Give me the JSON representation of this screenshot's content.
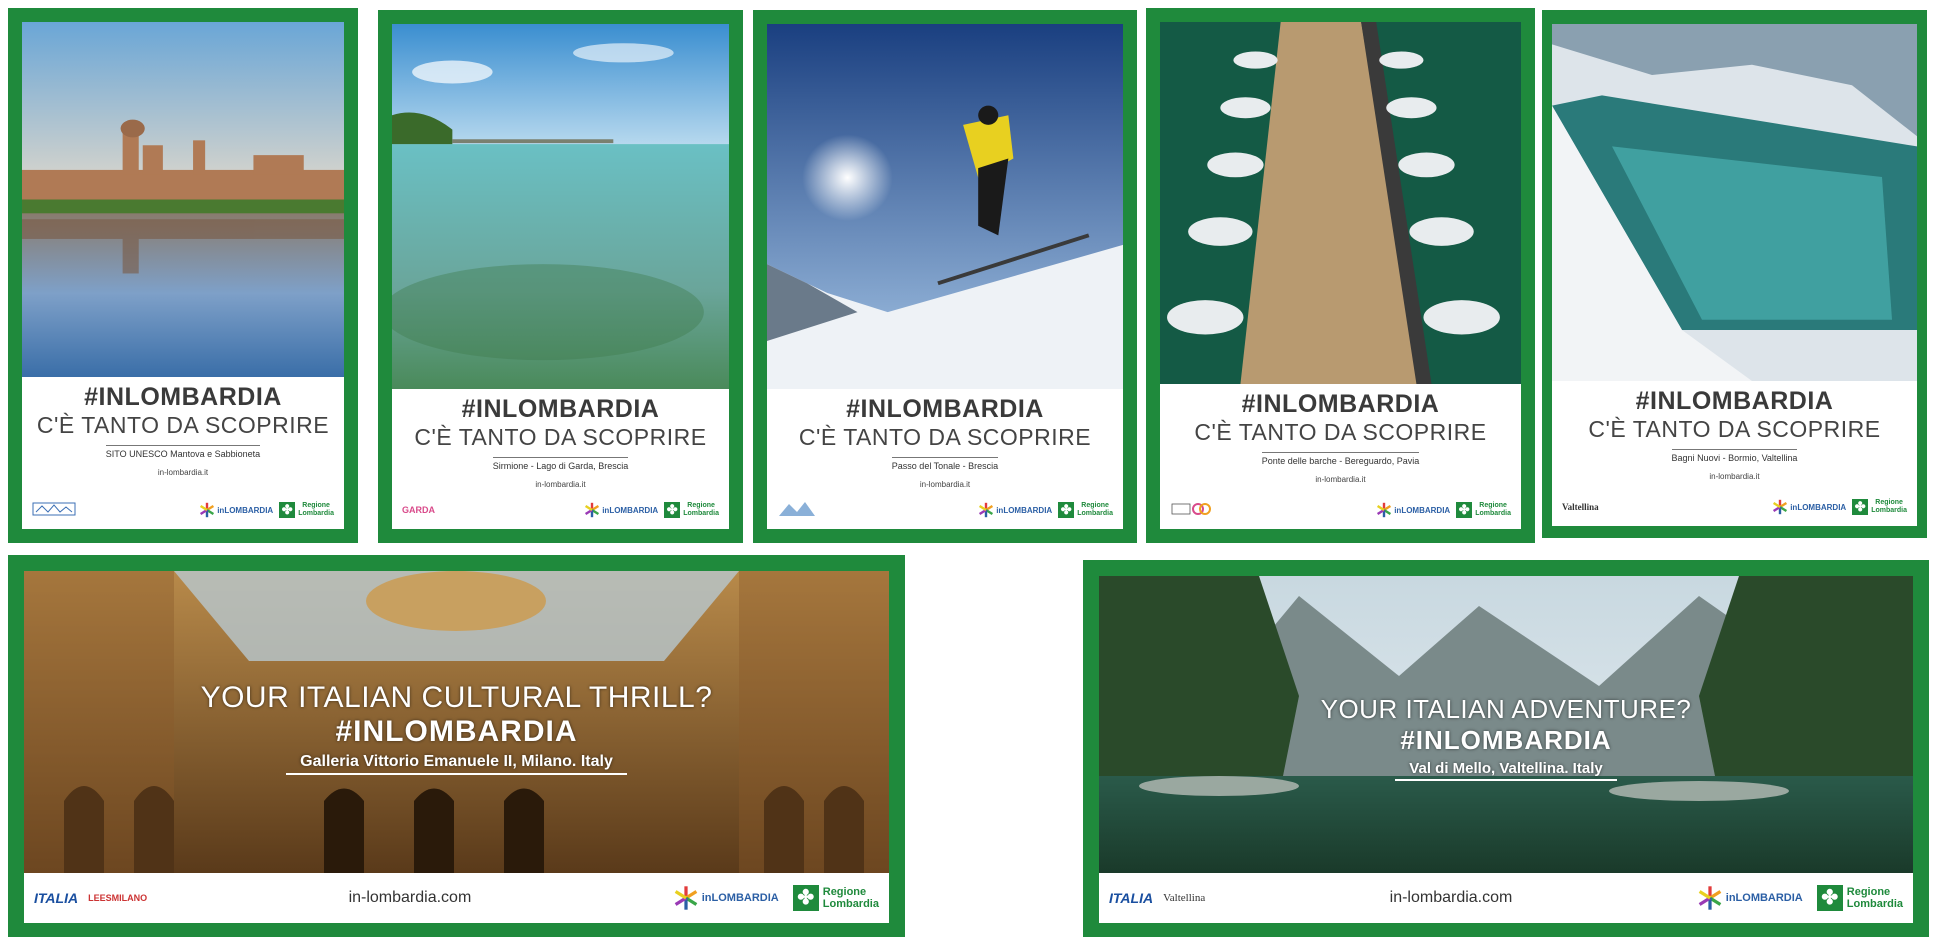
{
  "brand": {
    "green": "#1f8a3c",
    "hashtag": "#INLOMBARDIA",
    "tagline": "C'È TANTO DA SCOPRIRE",
    "inlombardia_logo": "inLOMBARDIA",
    "regione_logo_line1": "Regione",
    "regione_logo_line2": "Lombardia"
  },
  "posters": [
    {
      "location": "SITO UNESCO Mantova e Sabbioneta",
      "url": "in-lombardia.it",
      "partner_logo": "mantova-sabbioneta-logo"
    },
    {
      "location": "Sirmione - Lago di Garda, Brescia",
      "url": "in-lombardia.it",
      "partner_logo": "GARDA"
    },
    {
      "location": "Passo del Tonale - Brescia",
      "url": "in-lombardia.it",
      "partner_logo": "mountain-logo"
    },
    {
      "location": "Ponte delle barche - Bereguardo, Pavia",
      "url": "in-lombardia.it",
      "partner_logo": "pavia-logo"
    },
    {
      "location": "Bagni Nuovi - Bormio, Valtellina",
      "url": "in-lombardia.it",
      "partner_logo": "Valtellina"
    }
  ],
  "banners": [
    {
      "question": "YOUR ITALIAN CULTURAL THRILL?",
      "hashtag": "#INLOMBARDIA",
      "location": "Galleria Vittorio Emanuele II, Milano. Italy",
      "url": "in-lombardia.com",
      "logo1": "ITALIA",
      "logo2": "LEESMILANO"
    },
    {
      "question": "YOUR ITALIAN ADVENTURE?",
      "hashtag": "#INLOMBARDIA",
      "location": "Val di Mello, Valtellina. Italy",
      "url": "in-lombardia.com",
      "logo1": "ITALIA",
      "logo2": "Valtellina"
    }
  ]
}
